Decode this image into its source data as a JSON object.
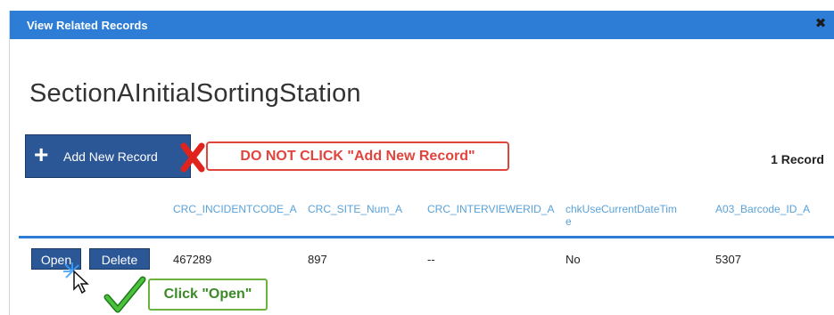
{
  "dialog": {
    "title": "View Related Records",
    "close_glyph": "✖",
    "heading": "SectionAInitialSortingStation",
    "add_button": "Add New Record",
    "warning": "DO NOT CLICK \"Add New Record\"",
    "record_count": "1 Record",
    "tip": "Click \"Open\""
  },
  "table": {
    "columns": [
      "CRC_INCIDENTCODE_A",
      "CRC_SITE_Num_A",
      "CRC_INTERVIEWERID_A",
      "chkUseCurrentDateTim",
      "e",
      "A03_Barcode_ID_A"
    ],
    "row": {
      "open_label": "Open",
      "delete_label": "Delete",
      "cells": [
        "467289",
        "897",
        "--",
        "No",
        "5307"
      ]
    }
  },
  "colors": {
    "titlebar": "#2d7cd6",
    "button": "#2b5797",
    "warning": "#e0453d",
    "tip": "#6bb33e"
  }
}
